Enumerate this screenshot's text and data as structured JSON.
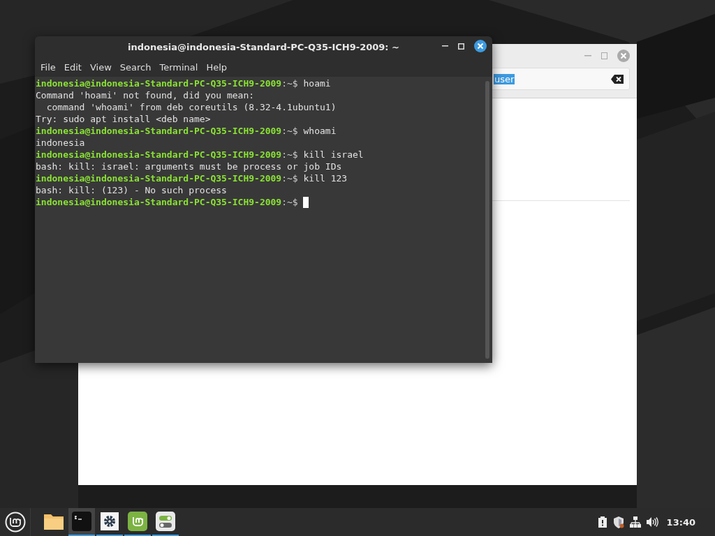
{
  "back_window": {
    "search": {
      "value": "user",
      "selected_text": true
    }
  },
  "terminal": {
    "title": "indonesia@indonesia-Standard-PC-Q35-ICH9-2009: ~",
    "menu": [
      "File",
      "Edit",
      "View",
      "Search",
      "Terminal",
      "Help"
    ],
    "lines": [
      {
        "kind": "prompt",
        "user_host": "indonesia@indonesia-Standard-PC-Q35-ICH9-2009",
        "path": ":~$",
        "command": "hoami"
      },
      {
        "kind": "output",
        "text": "Command 'hoami' not found, did you mean:"
      },
      {
        "kind": "output",
        "text": "  command 'whoami' from deb coreutils (8.32-4.1ubuntu1)"
      },
      {
        "kind": "output",
        "text": "Try: sudo apt install <deb name>"
      },
      {
        "kind": "prompt",
        "user_host": "indonesia@indonesia-Standard-PC-Q35-ICH9-2009",
        "path": ":~$",
        "command": "whoami"
      },
      {
        "kind": "output",
        "text": "indonesia"
      },
      {
        "kind": "prompt",
        "user_host": "indonesia@indonesia-Standard-PC-Q35-ICH9-2009",
        "path": ":~$",
        "command": "kill israel"
      },
      {
        "kind": "output",
        "text": "bash: kill: israel: arguments must be process or job IDs"
      },
      {
        "kind": "prompt",
        "user_host": "indonesia@indonesia-Standard-PC-Q35-ICH9-2009",
        "path": ":~$",
        "command": "kill 123"
      },
      {
        "kind": "output",
        "text": "bash: kill: (123) - No such process"
      },
      {
        "kind": "prompt",
        "user_host": "indonesia@indonesia-Standard-PC-Q35-ICH9-2009",
        "path": ":~$",
        "cursor": true
      }
    ]
  },
  "taskbar": {
    "apps": [
      {
        "kind": "folder",
        "running": false,
        "selected": false
      },
      {
        "kind": "terminal",
        "running": true,
        "selected": true
      },
      {
        "kind": "settings",
        "running": true,
        "selected": false
      },
      {
        "kind": "mint",
        "running": true,
        "selected": false
      },
      {
        "kind": "toggles",
        "running": true,
        "selected": false
      }
    ],
    "clock": "13:40"
  }
}
